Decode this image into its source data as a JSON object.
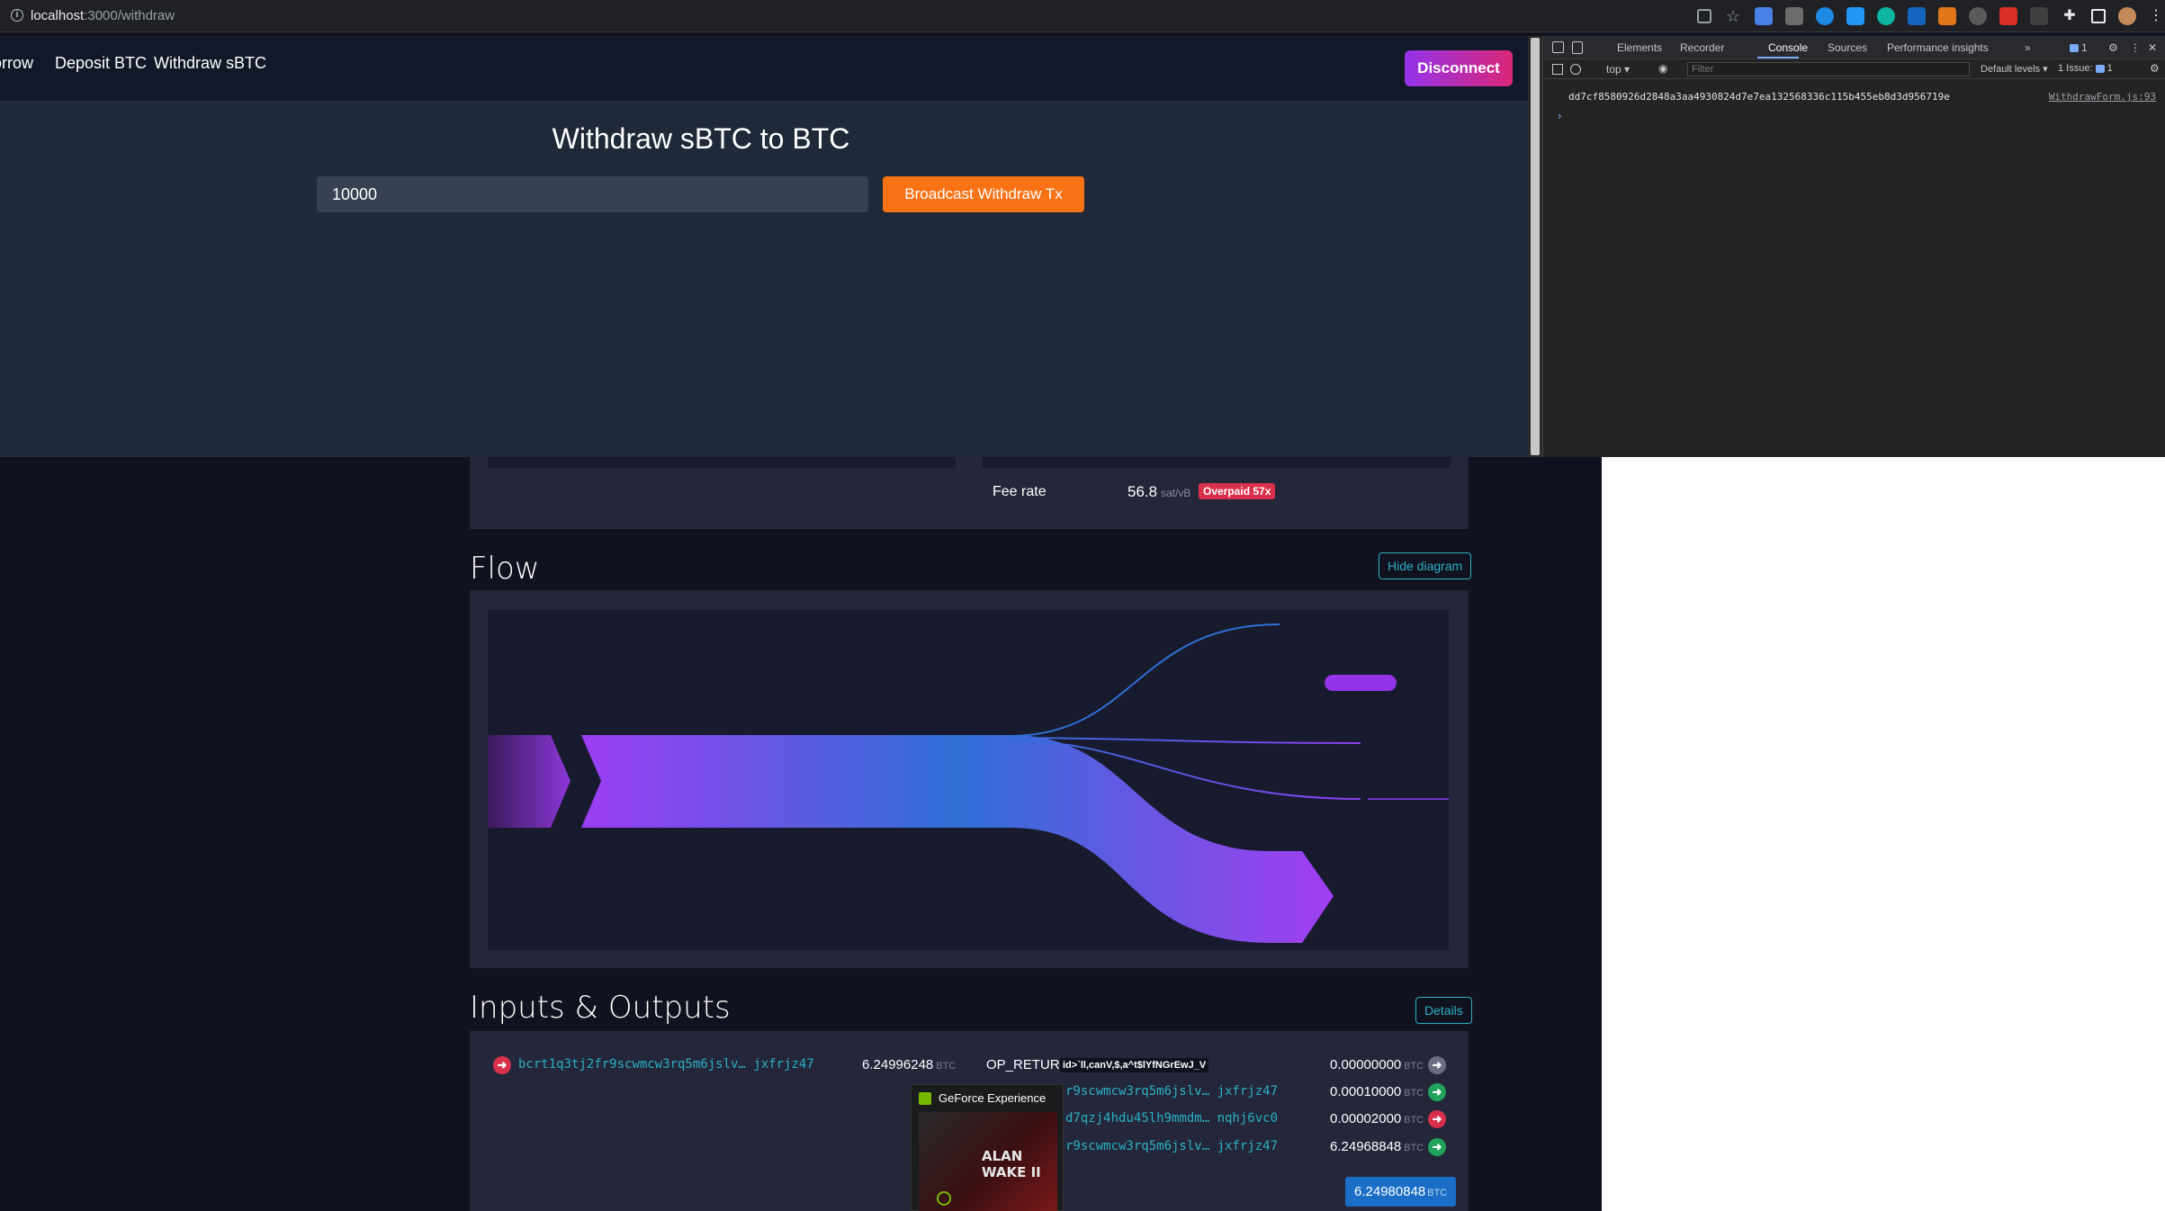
{
  "browser": {
    "url_host": "localhost",
    "url_path": ":3000/withdraw"
  },
  "app": {
    "nav": [
      {
        "label": "Borrow"
      },
      {
        "label": "Deposit BTC"
      },
      {
        "label": "Withdraw sBTC"
      }
    ],
    "disconnect_label": "Disconnect",
    "title": "Withdraw sBTC to BTC",
    "amount_value": "10000",
    "broadcast_label": "Broadcast Withdraw Tx"
  },
  "devtools": {
    "tabs": [
      "Elements",
      "Recorder",
      "Console",
      "Sources",
      "Performance insights"
    ],
    "active_tab": "Console",
    "context": "top",
    "filter_placeholder": "Filter",
    "levels": "Default levels",
    "issues": "1 Issue:",
    "issue_count": "1",
    "message_badge": "1",
    "console_message": "dd7cf8580926d2848a3aa4930824d7e7ea132568336c115b455eb8d3d956719e",
    "console_source": "WithdrawForm.js:93"
  },
  "mempool": {
    "fee_rate_label": "Fee rate",
    "fee_rate_value": "56.8",
    "fee_rate_unit": "sat/vB",
    "overpaid_badge": "Overpaid 57x",
    "flow_title": "Flow",
    "hide_diagram_label": "Hide diagram",
    "io_title": "Inputs & Outputs",
    "details_label": "Details",
    "input": {
      "address": "bcrt1q3tj2fr9scwmcw3rq5m6jslv… jxfrjz47",
      "amount": "6.24996248",
      "unit": "BTC"
    },
    "outputs": [
      {
        "address": "OP_RETURN",
        "data": "id>`ll,canV,$,a^t$lYfNGrEwJ_V",
        "amount": "0.00000000",
        "unit": "BTC"
      },
      {
        "address": "r9scwmcw3rq5m6jslv… jxfrjz47",
        "amount": "0.00010000",
        "unit": "BTC"
      },
      {
        "address": "d7qzj4hdu45lh9mmdm… nqhj6vc0",
        "amount": "0.00002000",
        "unit": "BTC"
      },
      {
        "address": "r9scwmcw3rq5m6jslv… jxfrjz47",
        "amount": "6.24968848",
        "unit": "BTC"
      }
    ],
    "total": "6.24980848",
    "total_unit": "BTC"
  },
  "overlay": {
    "title": "GeForce Experience",
    "thumbnail_text": "ALAN WAKE II"
  },
  "colors": {
    "accent_purple": "#9333ea",
    "accent_pink": "#db2777",
    "broadcast_orange": "#f97316",
    "link_cyan": "#2bb1c4",
    "overpaid_red": "#d9304c"
  }
}
